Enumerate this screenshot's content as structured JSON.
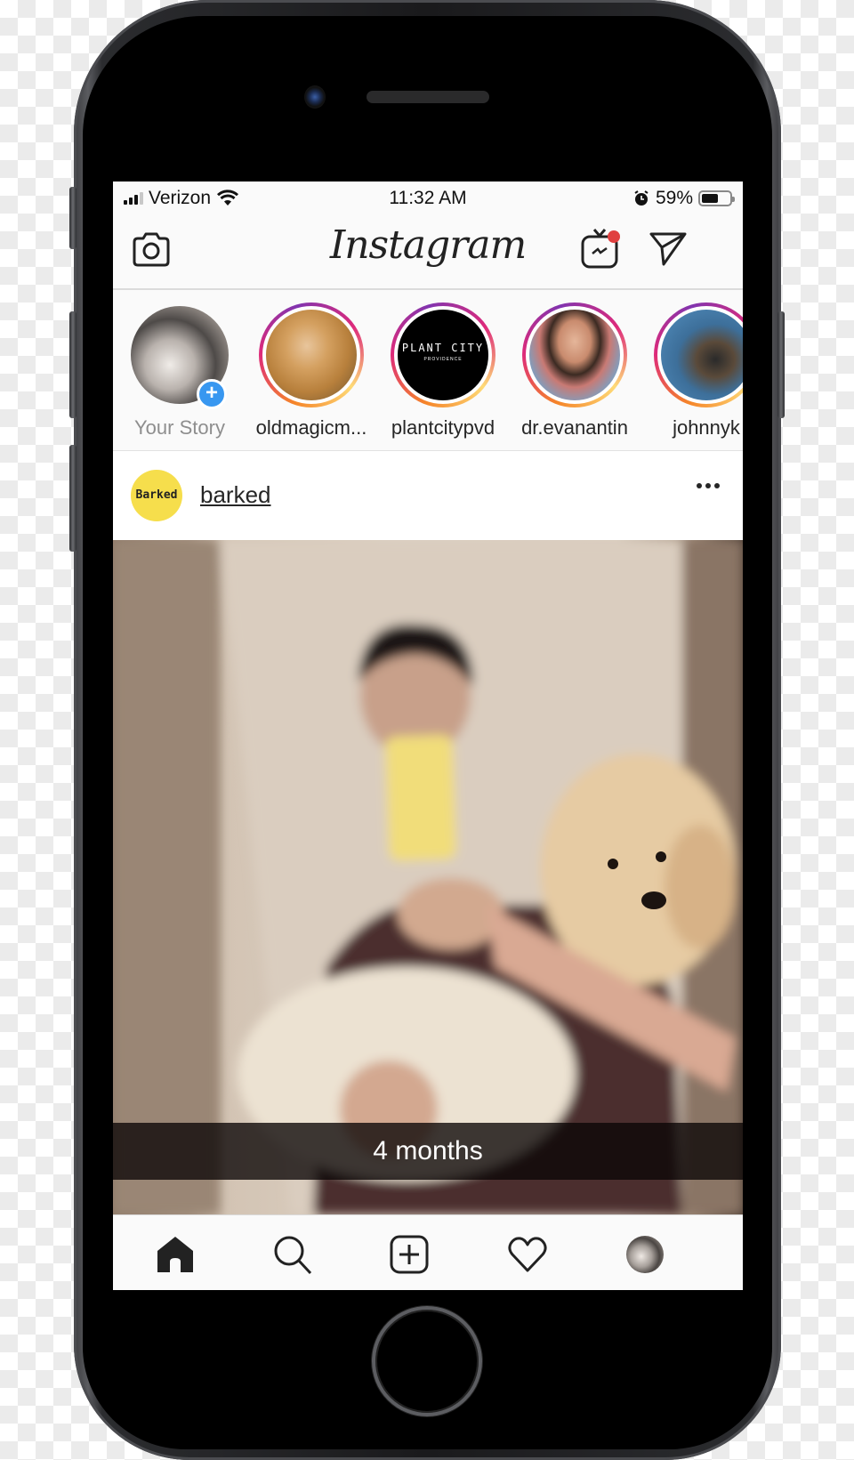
{
  "status_bar": {
    "carrier": "Verizon",
    "time": "11:32 AM",
    "battery_percent": "59%",
    "battery_level": 0.59,
    "signal_bars_active": 3,
    "signal_bars_total": 4
  },
  "top_bar": {
    "logo_text": "Instagram",
    "camera_icon": "camera-icon",
    "igtv_icon": "igtv-icon",
    "igtv_notification_color": "#e0403f",
    "direct_icon": "paper-plane-icon"
  },
  "stories": [
    {
      "label": "Your Story",
      "own": true
    },
    {
      "label": "oldmagicm...",
      "own": false
    },
    {
      "label": "plantcitypvd",
      "own": false,
      "avatar_text": "PLANT CITY",
      "avatar_subtext": "PROVIDENCE"
    },
    {
      "label": "dr.evanantin",
      "own": false
    },
    {
      "label": "johnnyk",
      "own": false
    }
  ],
  "post": {
    "username": "barked",
    "avatar_text": "Barked",
    "avatar_color": "#f6de4c",
    "caption_overlay": "4 months",
    "more_icon": "more-horizontal-icon"
  },
  "nav": {
    "items": [
      {
        "name": "home",
        "icon": "home-icon",
        "active": true
      },
      {
        "name": "search",
        "icon": "search-icon",
        "active": false
      },
      {
        "name": "new-post",
        "icon": "add-post-icon",
        "active": false
      },
      {
        "name": "activity",
        "icon": "heart-icon",
        "active": false
      },
      {
        "name": "profile",
        "icon": "profile-avatar",
        "active": false
      }
    ]
  },
  "colors": {
    "story_ring_from": "#f58529",
    "story_ring_to": "#8134af",
    "add_story_blue": "#3897f0"
  }
}
